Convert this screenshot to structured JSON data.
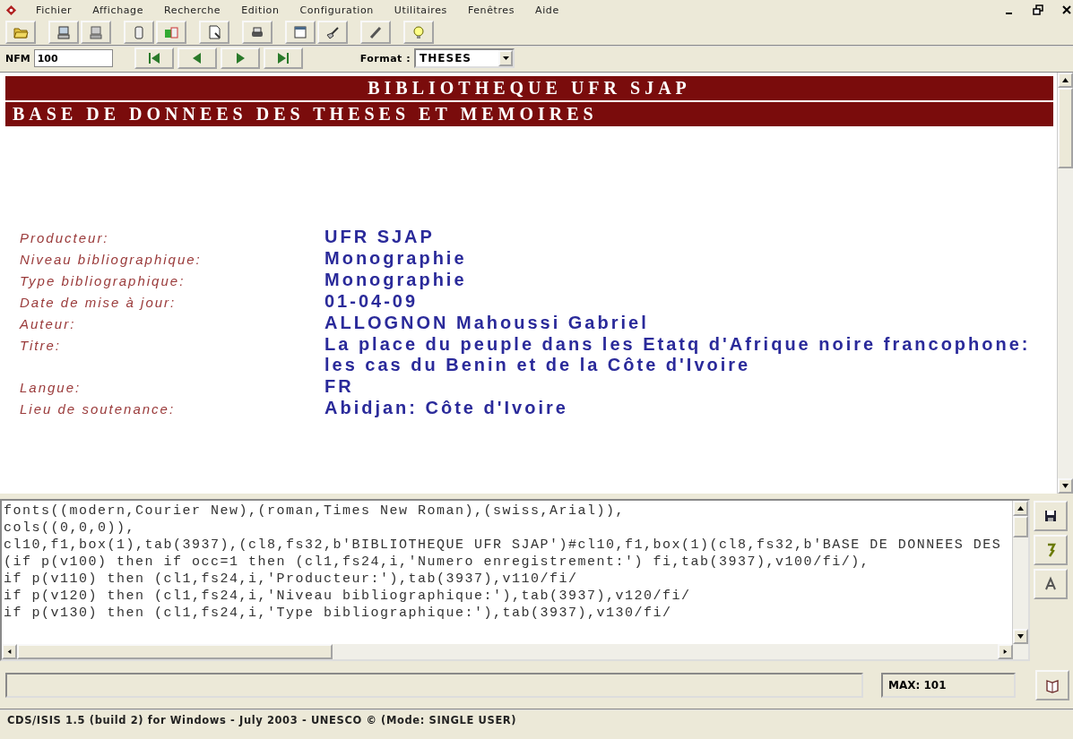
{
  "menu": [
    "Fichier",
    "Affichage",
    "Recherche",
    "Edition",
    "Configuration",
    "Utilitaires",
    "Fenêtres",
    "Aide"
  ],
  "navigation": {
    "mfn_label": "NFM",
    "mfn_value": "100",
    "format_label": "Format :",
    "format_value": "THESES"
  },
  "banner": {
    "title": "BIBLIOTHEQUE UFR SJAP",
    "subtitle": "BASE DE DONNEES DES THESES ET MEMOIRES"
  },
  "fields": [
    {
      "label": "Producteur:",
      "value": "UFR SJAP"
    },
    {
      "label": "Niveau bibliographique:",
      "value": "Monographie"
    },
    {
      "label": "Type bibliographique:",
      "value": "Monographie"
    },
    {
      "label": "Date de mise à jour:",
      "value": "01-04-09"
    },
    {
      "label": "Auteur:",
      "value": "ALLOGNON Mahoussi Gabriel"
    },
    {
      "label": "Titre:",
      "value": "La place du peuple dans les Etatq d'Afrique noire francophone: les cas du Benin et de la Côte d'Ivoire"
    },
    {
      "label": "Langue:",
      "value": "FR"
    },
    {
      "label": "Lieu de soutenance:",
      "value": "Abidjan: Côte d'Ivoire"
    }
  ],
  "editor": {
    "lines": [
      "fonts((modern,Courier New),(roman,Times New Roman),(swiss,Arial)),",
      "cols((0,0,0)),",
      "cl10,f1,box(1),tab(3937),(cl8,fs32,b'BIBLIOTHEQUE UFR SJAP')#cl10,f1,box(1)(cl8,fs32,b'BASE DE DONNEES DES",
      "(if p(v100) then if occ=1 then (cl1,fs24,i,'Numero enregistrement:') fi,tab(3937),v100/fi/),",
      "if p(v110) then (cl1,fs24,i,'Producteur:'),tab(3937),v110/fi/",
      "if p(v120) then (cl1,fs24,i,'Niveau bibliographique:'),tab(3937),v120/fi/",
      "if p(v130) then (cl1,fs24,i,'Type bibliographique:'),tab(3937),v130/fi/"
    ]
  },
  "counter": "MAX: 101",
  "status_bar": "CDS/ISIS 1.5 (build 2) for Windows - July 2003 - UNESCO © (Mode: SINGLE USER)"
}
